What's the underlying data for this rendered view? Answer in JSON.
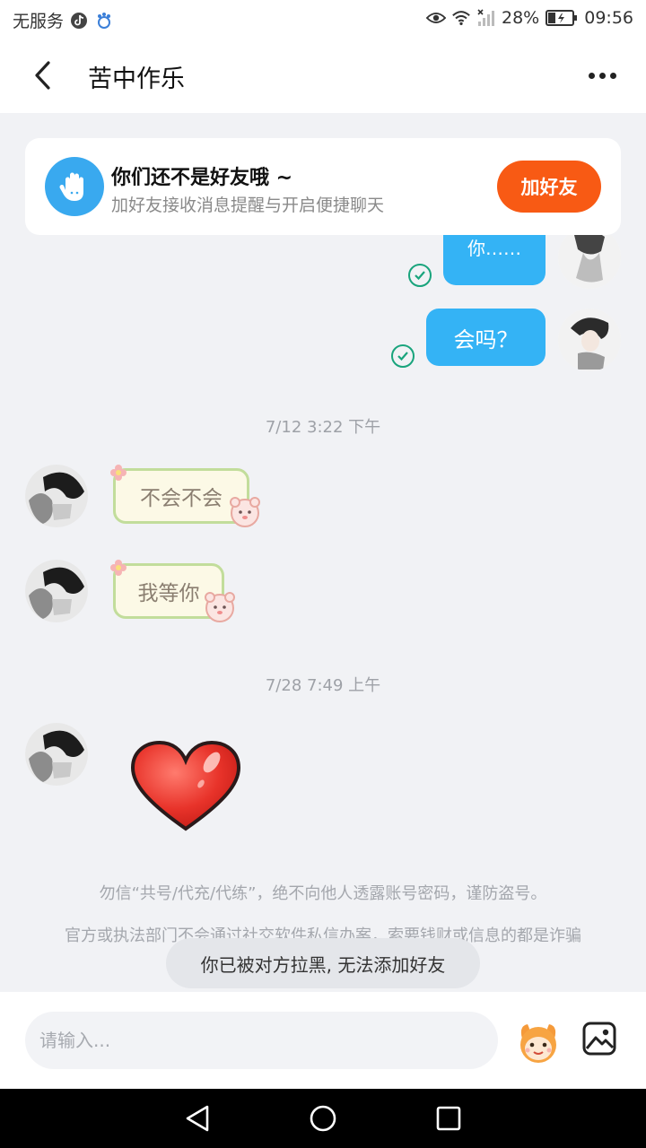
{
  "status_bar": {
    "carrier": "无服务",
    "battery": "28%",
    "time": "09:56"
  },
  "header": {
    "title": "苦中作乐"
  },
  "friend_card": {
    "title": "你们还不是好友哦 ~",
    "subtitle": "加好友接收消息提醒与开启便捷聊天",
    "add_button": "加好友"
  },
  "messages": {
    "sent_1": "你……",
    "sent_2": "会吗？",
    "timestamp_1": "7/12 3:22 下午",
    "recv_1": "不会不会",
    "recv_2": "我等你",
    "timestamp_2": "7/28 7:49 上午"
  },
  "notices": {
    "line_1": "勿信“共号/代充/代练”，绝不向他人透露账号密码，谨防盗号。",
    "line_2": "官方或执法部门不会通过社交软件私信办案，索要钱财或信息的都是诈骗"
  },
  "toast": "你已被对方拉黑, 无法添加好友",
  "input": {
    "placeholder": "请输入..."
  },
  "colors": {
    "accent_orange": "#f85a14",
    "bubble_blue": "#34b3f5",
    "check_green": "#19a47c"
  }
}
